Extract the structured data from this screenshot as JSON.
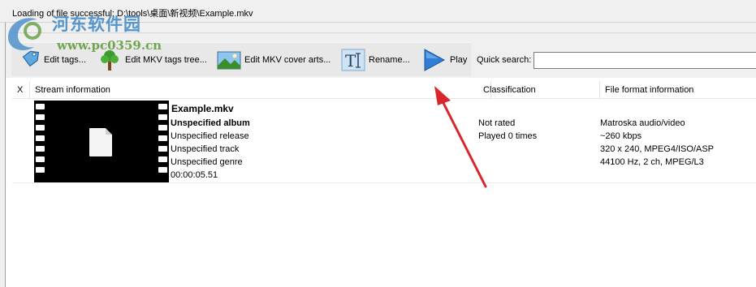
{
  "status": {
    "message": "Loading of file successful: D:\\tools\\桌面\\新视频\\Example.mkv"
  },
  "watermark": {
    "title": "河东软件园",
    "url": "www.pc0359.cn"
  },
  "toolbar": {
    "edit_tags": "Edit tags...",
    "edit_mkv_tree": "Edit MKV tags tree...",
    "edit_cover": "Edit MKV cover arts...",
    "rename": "Rename...",
    "play": "Play"
  },
  "search": {
    "label": "Quick search:",
    "value": ""
  },
  "grid": {
    "columns": {
      "x": "X",
      "stream": "Stream information",
      "classification": "Classification",
      "format": "File format information"
    },
    "rows": [
      {
        "filename": "Example.mkv",
        "album": "Unspecified album",
        "release": "Unspecified release",
        "track": "Unspecified track",
        "genre": "Unspecified genre",
        "duration": "00:00:05.51",
        "rating": "Not rated",
        "played": "Played 0 times",
        "format": "Matroska audio/video",
        "bitrate": "~260 kbps",
        "video": "320 x 240, MPEG4/ISO/ASP",
        "audio": "44100 Hz, 2 ch, MPEG/L3"
      }
    ]
  },
  "colors": {
    "arrow": "#d9262b",
    "watermark_blue": "#3a86c6",
    "watermark_green": "#5b9a35"
  },
  "icons": [
    "tag-icon",
    "tree-icon",
    "landscape-icon",
    "rename-icon",
    "play-icon",
    "file-icon",
    "logo-icon"
  ]
}
